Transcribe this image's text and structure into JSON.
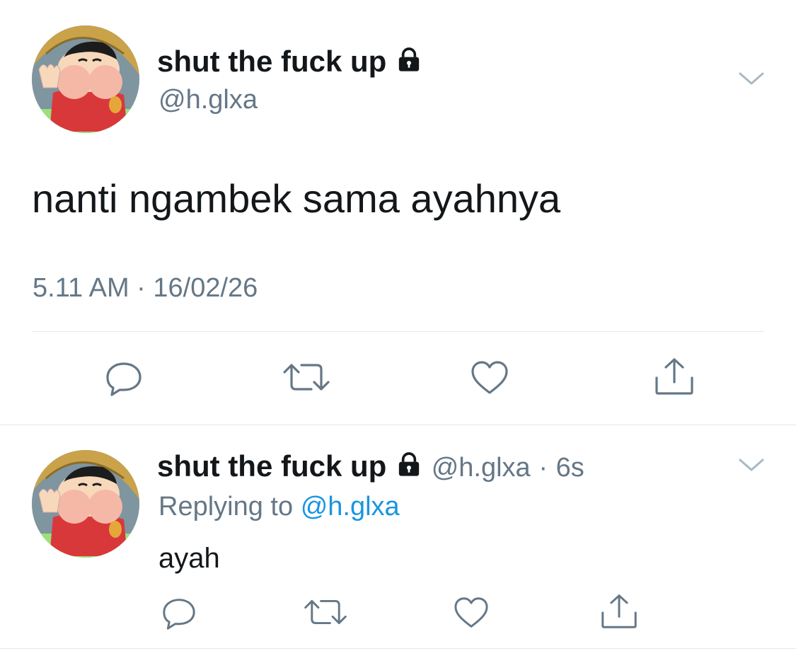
{
  "colors": {
    "text": "#14171a",
    "muted": "#657786",
    "link": "#1b95e0",
    "divider": "#e1e8ed"
  },
  "main_tweet": {
    "display_name": "shut the fuck up",
    "handle": "@h.glxa",
    "text": "nanti ngambek sama ayahnya",
    "time": "5.11 AM",
    "separator": "·",
    "date": "16/02/26",
    "icons": [
      "lock-icon",
      "chevron-down-icon",
      "reply-icon",
      "retweet-icon",
      "like-icon",
      "share-icon"
    ]
  },
  "reply_tweet": {
    "display_name": "shut the fuck up",
    "handle": "@h.glxa",
    "separator": "·",
    "age": "6s",
    "replying_prefix": "Replying to",
    "replying_to": "@h.glxa",
    "text": "ayah",
    "icons": [
      "lock-icon",
      "chevron-down-icon",
      "reply-icon",
      "retweet-icon",
      "like-icon",
      "share-icon"
    ]
  }
}
